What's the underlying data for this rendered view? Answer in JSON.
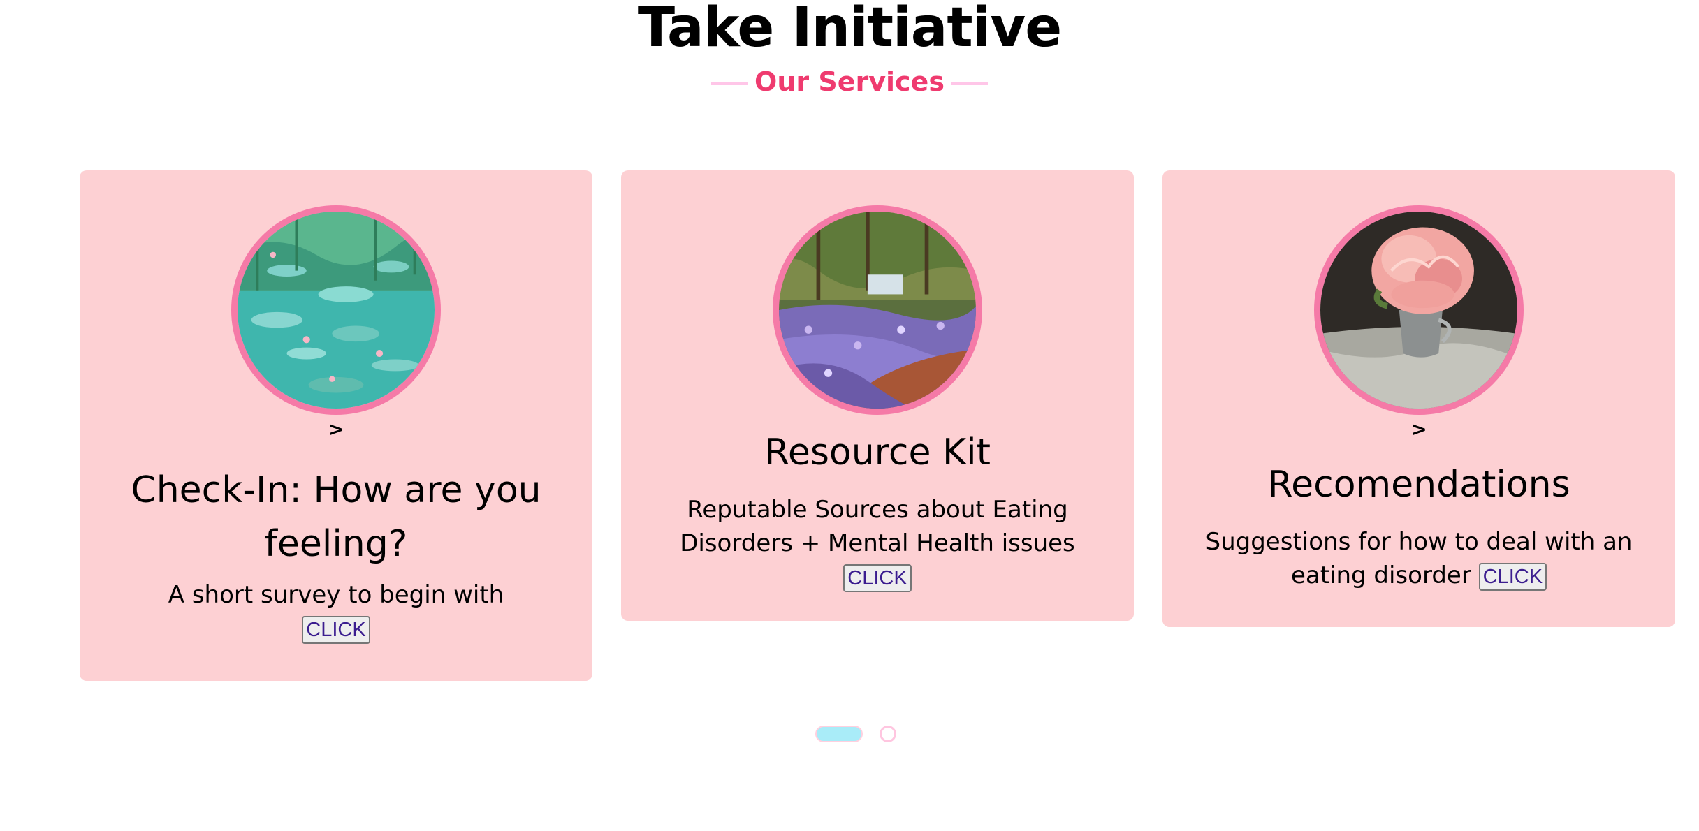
{
  "header": {
    "title": "Take Initiative",
    "subtitle": "Our Services"
  },
  "cards": [
    {
      "chevron": ">",
      "title": "Check-In: How are you feeling?",
      "description": "A short survey to begin with",
      "button": "CLICK",
      "image": "water-lilies-painting"
    },
    {
      "title": "Resource Kit",
      "description": "Reputable Sources about Eating Disorders + Mental Health issues",
      "button": "CLICK",
      "image": "garden-irises-painting"
    },
    {
      "chevron": ">",
      "title": "Recomendations",
      "description": "Suggestions for how to deal with an eating disorder",
      "button": "CLICK",
      "image": "pink-peony-vase-painting"
    }
  ],
  "carousel": {
    "pages": 2,
    "active_page": 1
  },
  "colors": {
    "card_bg": "#fdd0d3",
    "avatar_border": "#f57aa7",
    "subtitle": "#ef3b6f",
    "subtitle_line": "#ffc6e8",
    "dot_active": "#a9ecf8"
  }
}
